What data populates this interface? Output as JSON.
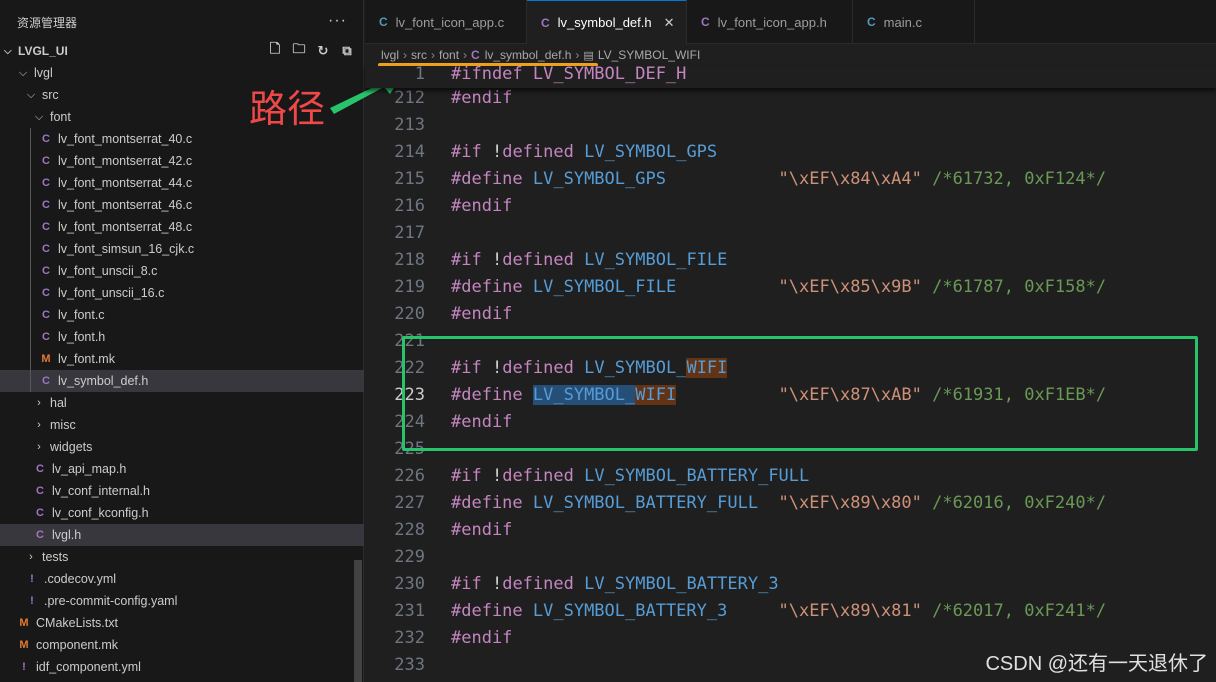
{
  "sidebar": {
    "title": "资源管理器",
    "more": "···",
    "project": "LVGL_UI",
    "tree": [
      {
        "label": "lvgl",
        "kind": "folder",
        "open": true,
        "depth": 1
      },
      {
        "label": "src",
        "kind": "folder",
        "open": true,
        "depth": 2
      },
      {
        "label": "font",
        "kind": "folder",
        "open": true,
        "depth": 3
      },
      {
        "label": "lv_font_montserrat_40.c",
        "kind": "c",
        "depth": 4
      },
      {
        "label": "lv_font_montserrat_42.c",
        "kind": "c",
        "depth": 4
      },
      {
        "label": "lv_font_montserrat_44.c",
        "kind": "c",
        "depth": 4
      },
      {
        "label": "lv_font_montserrat_46.c",
        "kind": "c",
        "depth": 4
      },
      {
        "label": "lv_font_montserrat_48.c",
        "kind": "c",
        "depth": 4
      },
      {
        "label": "lv_font_simsun_16_cjk.c",
        "kind": "c",
        "depth": 4
      },
      {
        "label": "lv_font_unscii_8.c",
        "kind": "c",
        "depth": 4
      },
      {
        "label": "lv_font_unscii_16.c",
        "kind": "c",
        "depth": 4
      },
      {
        "label": "lv_font.c",
        "kind": "c",
        "depth": 4
      },
      {
        "label": "lv_font.h",
        "kind": "c",
        "depth": 4
      },
      {
        "label": "lv_font.mk",
        "kind": "m",
        "depth": 4
      },
      {
        "label": "lv_symbol_def.h",
        "kind": "c",
        "depth": 4,
        "selected": true
      },
      {
        "label": "hal",
        "kind": "folder",
        "open": false,
        "depth": 3
      },
      {
        "label": "misc",
        "kind": "folder",
        "open": false,
        "depth": 3
      },
      {
        "label": "widgets",
        "kind": "folder",
        "open": false,
        "depth": 3
      },
      {
        "label": "lv_api_map.h",
        "kind": "c",
        "depth": 3
      },
      {
        "label": "lv_conf_internal.h",
        "kind": "c",
        "depth": 3
      },
      {
        "label": "lv_conf_kconfig.h",
        "kind": "c",
        "depth": 3
      },
      {
        "label": "lvgl.h",
        "kind": "c",
        "depth": 3,
        "selected": true
      },
      {
        "label": "tests",
        "kind": "folder",
        "open": false,
        "depth": 2
      },
      {
        "label": ".codecov.yml",
        "kind": "y",
        "depth": 2
      },
      {
        "label": ".pre-commit-config.yaml",
        "kind": "y",
        "depth": 2
      },
      {
        "label": "CMakeLists.txt",
        "kind": "m",
        "depth": 1
      },
      {
        "label": "component.mk",
        "kind": "m",
        "depth": 1
      },
      {
        "label": "idf_component.yml",
        "kind": "y",
        "depth": 1
      }
    ]
  },
  "tabs": [
    {
      "label": "lv_font_icon_app.c",
      "active": false
    },
    {
      "label": "lv_symbol_def.h",
      "active": true,
      "close": "✕"
    },
    {
      "label": "lv_font_icon_app.h",
      "active": false
    },
    {
      "label": "main.c",
      "active": false
    }
  ],
  "breadcrumb": {
    "parts": [
      "lvgl",
      "src",
      "font",
      "lv_symbol_def.h",
      "LV_SYMBOL_WIFI"
    ]
  },
  "annotation": {
    "label": "路径"
  },
  "watermark": "CSDN @还有一天退休了",
  "editor": {
    "sticky": {
      "num": "1",
      "text": "#ifndef LV_SYMBOL_DEF_H"
    },
    "lines": [
      {
        "num": "212",
        "type": "endif"
      },
      {
        "num": "213",
        "type": "blank"
      },
      {
        "num": "214",
        "type": "if",
        "symbol": "LV_SYMBOL_GPS"
      },
      {
        "num": "215",
        "type": "define",
        "symbol": "LV_SYMBOL_GPS",
        "value": "\"\\xEF\\x84\\xA4\"",
        "comment": "/*61732, 0xF124*/"
      },
      {
        "num": "216",
        "type": "endif"
      },
      {
        "num": "217",
        "type": "blank"
      },
      {
        "num": "218",
        "type": "if",
        "symbol": "LV_SYMBOL_FILE"
      },
      {
        "num": "219",
        "type": "define",
        "symbol": "LV_SYMBOL_FILE",
        "value": "\"\\xEF\\x85\\x9B\"",
        "comment": "/*61787, 0xF158*/"
      },
      {
        "num": "220",
        "type": "endif"
      },
      {
        "num": "221",
        "type": "blank"
      },
      {
        "num": "222",
        "type": "if",
        "symbol": "LV_SYMBOL_WIFI"
      },
      {
        "num": "223",
        "type": "define",
        "symbol": "LV_SYMBOL_WIFI",
        "value": "\"\\xEF\\x87\\xAB\"",
        "comment": "/*61931, 0xF1EB*/",
        "current": true
      },
      {
        "num": "224",
        "type": "endif"
      },
      {
        "num": "225",
        "type": "blank"
      },
      {
        "num": "226",
        "type": "if",
        "symbol": "LV_SYMBOL_BATTERY_FULL"
      },
      {
        "num": "227",
        "type": "define",
        "symbol": "LV_SYMBOL_BATTERY_FULL",
        "value": "\"\\xEF\\x89\\x80\"",
        "comment": "/*62016, 0xF240*/"
      },
      {
        "num": "228",
        "type": "endif"
      },
      {
        "num": "229",
        "type": "blank"
      },
      {
        "num": "230",
        "type": "if",
        "symbol": "LV_SYMBOL_BATTERY_3"
      },
      {
        "num": "231",
        "type": "define",
        "symbol": "LV_SYMBOL_BATTERY_3",
        "value": "\"\\xEF\\x89\\x81\"",
        "comment": "/*62017, 0xF241*/"
      },
      {
        "num": "232",
        "type": "endif"
      },
      {
        "num": "233",
        "type": "blank"
      }
    ]
  },
  "colors": {
    "accent": "#0078d4",
    "annotation_box": "#27c46b",
    "annotation_arrow": "#27c46b",
    "annotation_text": "#f04848",
    "underline": "#f3a21c"
  }
}
